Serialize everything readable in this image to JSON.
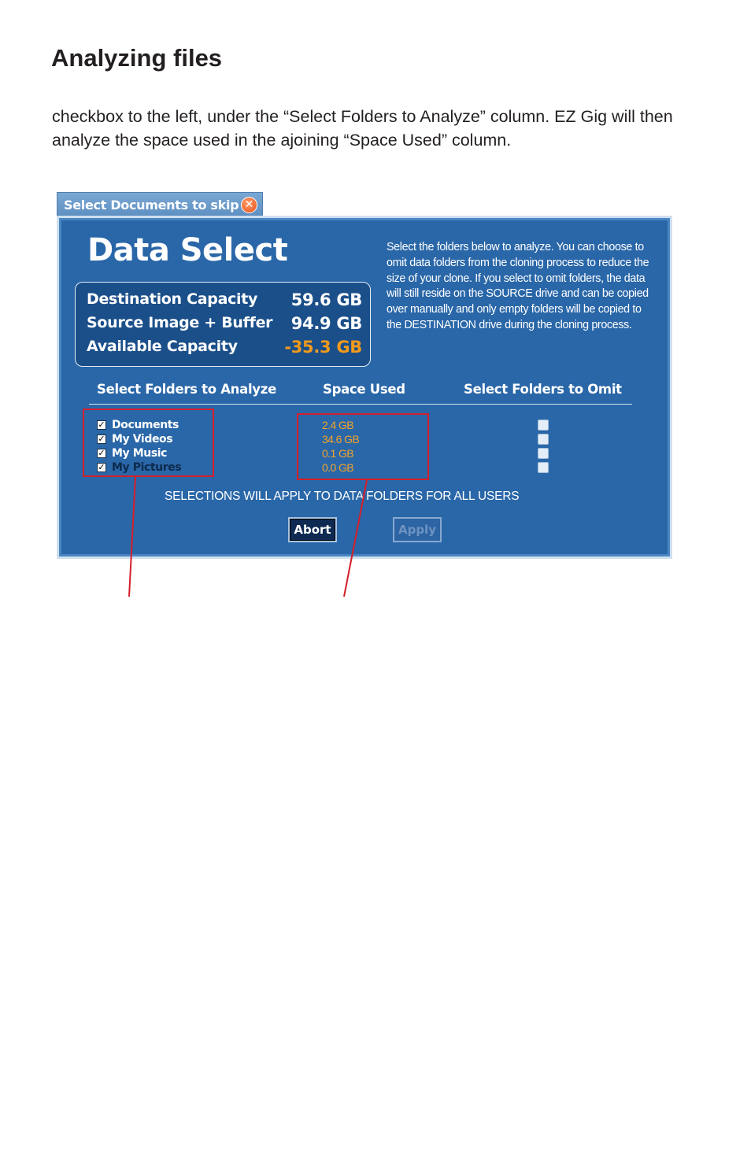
{
  "page": {
    "heading": "Analyzing files",
    "body_text": "checkbox to the left, under the “Select Folders to Analyze” column. EZ Gig will then analyze the space used in the ajoining “Space Used” column."
  },
  "dialog": {
    "tab_title": "Select Documents to skip",
    "close_glyph": "✕",
    "title": "Data Select",
    "capacity": {
      "destination_label": "Destination Capacity",
      "destination_value": "59.6 GB",
      "source_label": "Source Image + Buffer",
      "source_value": "94.9 GB",
      "available_label": "Available Capacity",
      "available_value": "-35.3 GB"
    },
    "description": "Select the folders below to analyze. You can choose to omit data folders from the cloning process to reduce the size of your clone.  If you select to omit folders, the data will still reside on the SOURCE drive and can be copied over manually and only empty folders will be copied to the DESTINATION drive during the cloning process.",
    "columns": {
      "analyze": "Select Folders to Analyze",
      "space": "Space Used",
      "omit": "Select Folders to Omit"
    },
    "folders": [
      {
        "name": "Documents",
        "size": "2.4 GB"
      },
      {
        "name": "My Videos",
        "size": "34.6 GB"
      },
      {
        "name": "My Music",
        "size": "0.1 GB"
      },
      {
        "name": "My Pictures",
        "size": "0.0 GB"
      }
    ],
    "check_glyph": "✓",
    "notice": "SELECTIONS WILL APPLY TO DATA FOLDERS FOR ALL USERS",
    "abort_label": "Abort",
    "apply_label": "Apply"
  },
  "colors": {
    "panel": "#2a67a8",
    "accent_orange": "#f29a1b",
    "annotation_red": "#d41f2a"
  }
}
